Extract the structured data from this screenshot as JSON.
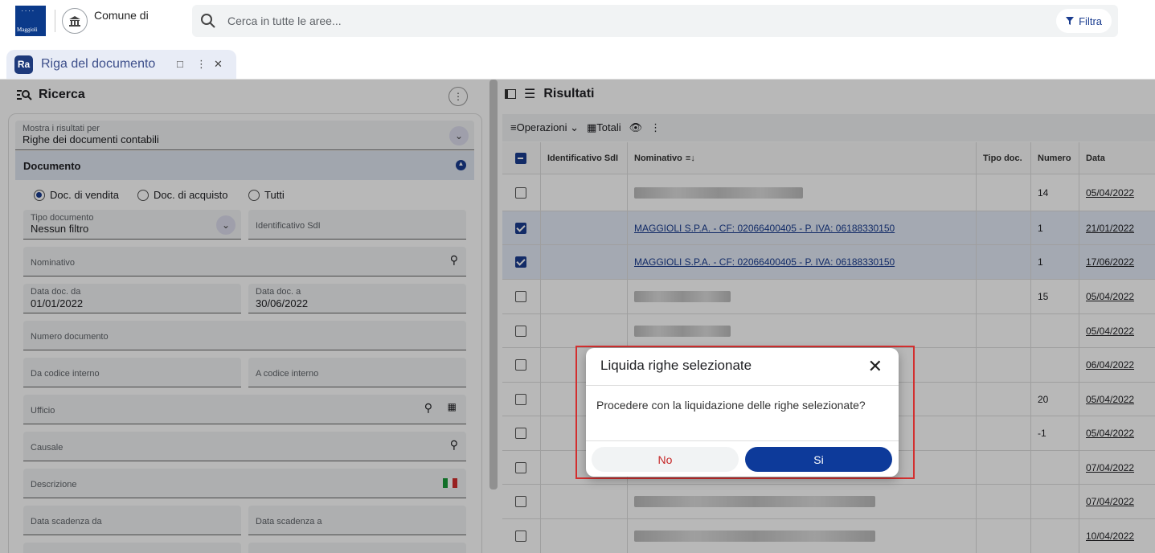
{
  "app": {
    "logo_label": "Maggioli",
    "inst_name": "Comune di",
    "search_placeholder": "Cerca in tutte le aree...",
    "filter_label": "Filtra"
  },
  "tab": {
    "icon_text": "Ra",
    "title": "Riga del documento"
  },
  "search_panel": {
    "title": "Ricerca",
    "show_for_label": "Mostra i risultati per",
    "show_for_value": "Righe dei documenti contabili",
    "section": "Documento",
    "radios": [
      "Doc. di vendita",
      "Doc. di acquisto",
      "Tutti"
    ],
    "radio_selected": 0,
    "tipo_label": "Tipo documento",
    "tipo_value": "Nessun filtro",
    "sdi_label": "Identificativo SdI",
    "nominativo_label": "Nominativo",
    "data_da_label": "Data doc. da",
    "data_da_value": "01/01/2022",
    "data_a_label": "Data doc. a",
    "data_a_value": "30/06/2022",
    "numero_label": "Numero documento",
    "cod_da_label": "Da codice interno",
    "cod_a_label": "A codice interno",
    "ufficio_label": "Ufficio",
    "causale_label": "Causale",
    "descrizione_label": "Descrizione",
    "scad_da_label": "Data scadenza da",
    "scad_a_label": "Data scadenza a"
  },
  "results": {
    "title": "Risultati",
    "ops_label": "Operazioni",
    "totali_label": "Totali",
    "columns": [
      "Identificativo SdI",
      "Nominativo",
      "Tipo doc.",
      "Numero",
      "Data"
    ],
    "rows": [
      {
        "nominativo": "",
        "numero": "14",
        "data": "05/04/2022",
        "checked": false
      },
      {
        "nominativo": "MAGGIOLI S.P.A. - CF: 02066400405 - P. IVA: 06188330150",
        "numero": "1",
        "data": "21/01/2022",
        "checked": true
      },
      {
        "nominativo": "MAGGIOLI S.P.A. - CF: 02066400405 - P. IVA: 06188330150",
        "numero": "1",
        "data": "17/06/2022",
        "checked": true
      },
      {
        "nominativo": "",
        "numero": "15",
        "data": "05/04/2022",
        "checked": false
      },
      {
        "nominativo": "",
        "numero": "",
        "data": "05/04/2022",
        "checked": false
      },
      {
        "nominativo": "",
        "numero": "",
        "data": "06/04/2022",
        "checked": false
      },
      {
        "nominativo": "",
        "numero": "20",
        "data": "05/04/2022",
        "checked": false
      },
      {
        "nominativo": "",
        "numero": "-1",
        "data": "05/04/2022",
        "checked": false
      },
      {
        "nominativo": "",
        "numero": "",
        "data": "07/04/2022",
        "checked": false
      },
      {
        "nominativo": "",
        "numero": "",
        "data": "07/04/2022",
        "checked": false
      },
      {
        "nominativo": "",
        "numero": "",
        "data": "10/04/2022",
        "checked": false
      }
    ]
  },
  "dialog": {
    "title": "Liquida righe selezionate",
    "message": "Procedere con la liquidazione delle righe selezionate?",
    "no_label": "No",
    "yes_label": "Si"
  },
  "colors": {
    "accent": "#0d3a9a",
    "no": "#c62828",
    "highlight": "#d32f2f"
  }
}
